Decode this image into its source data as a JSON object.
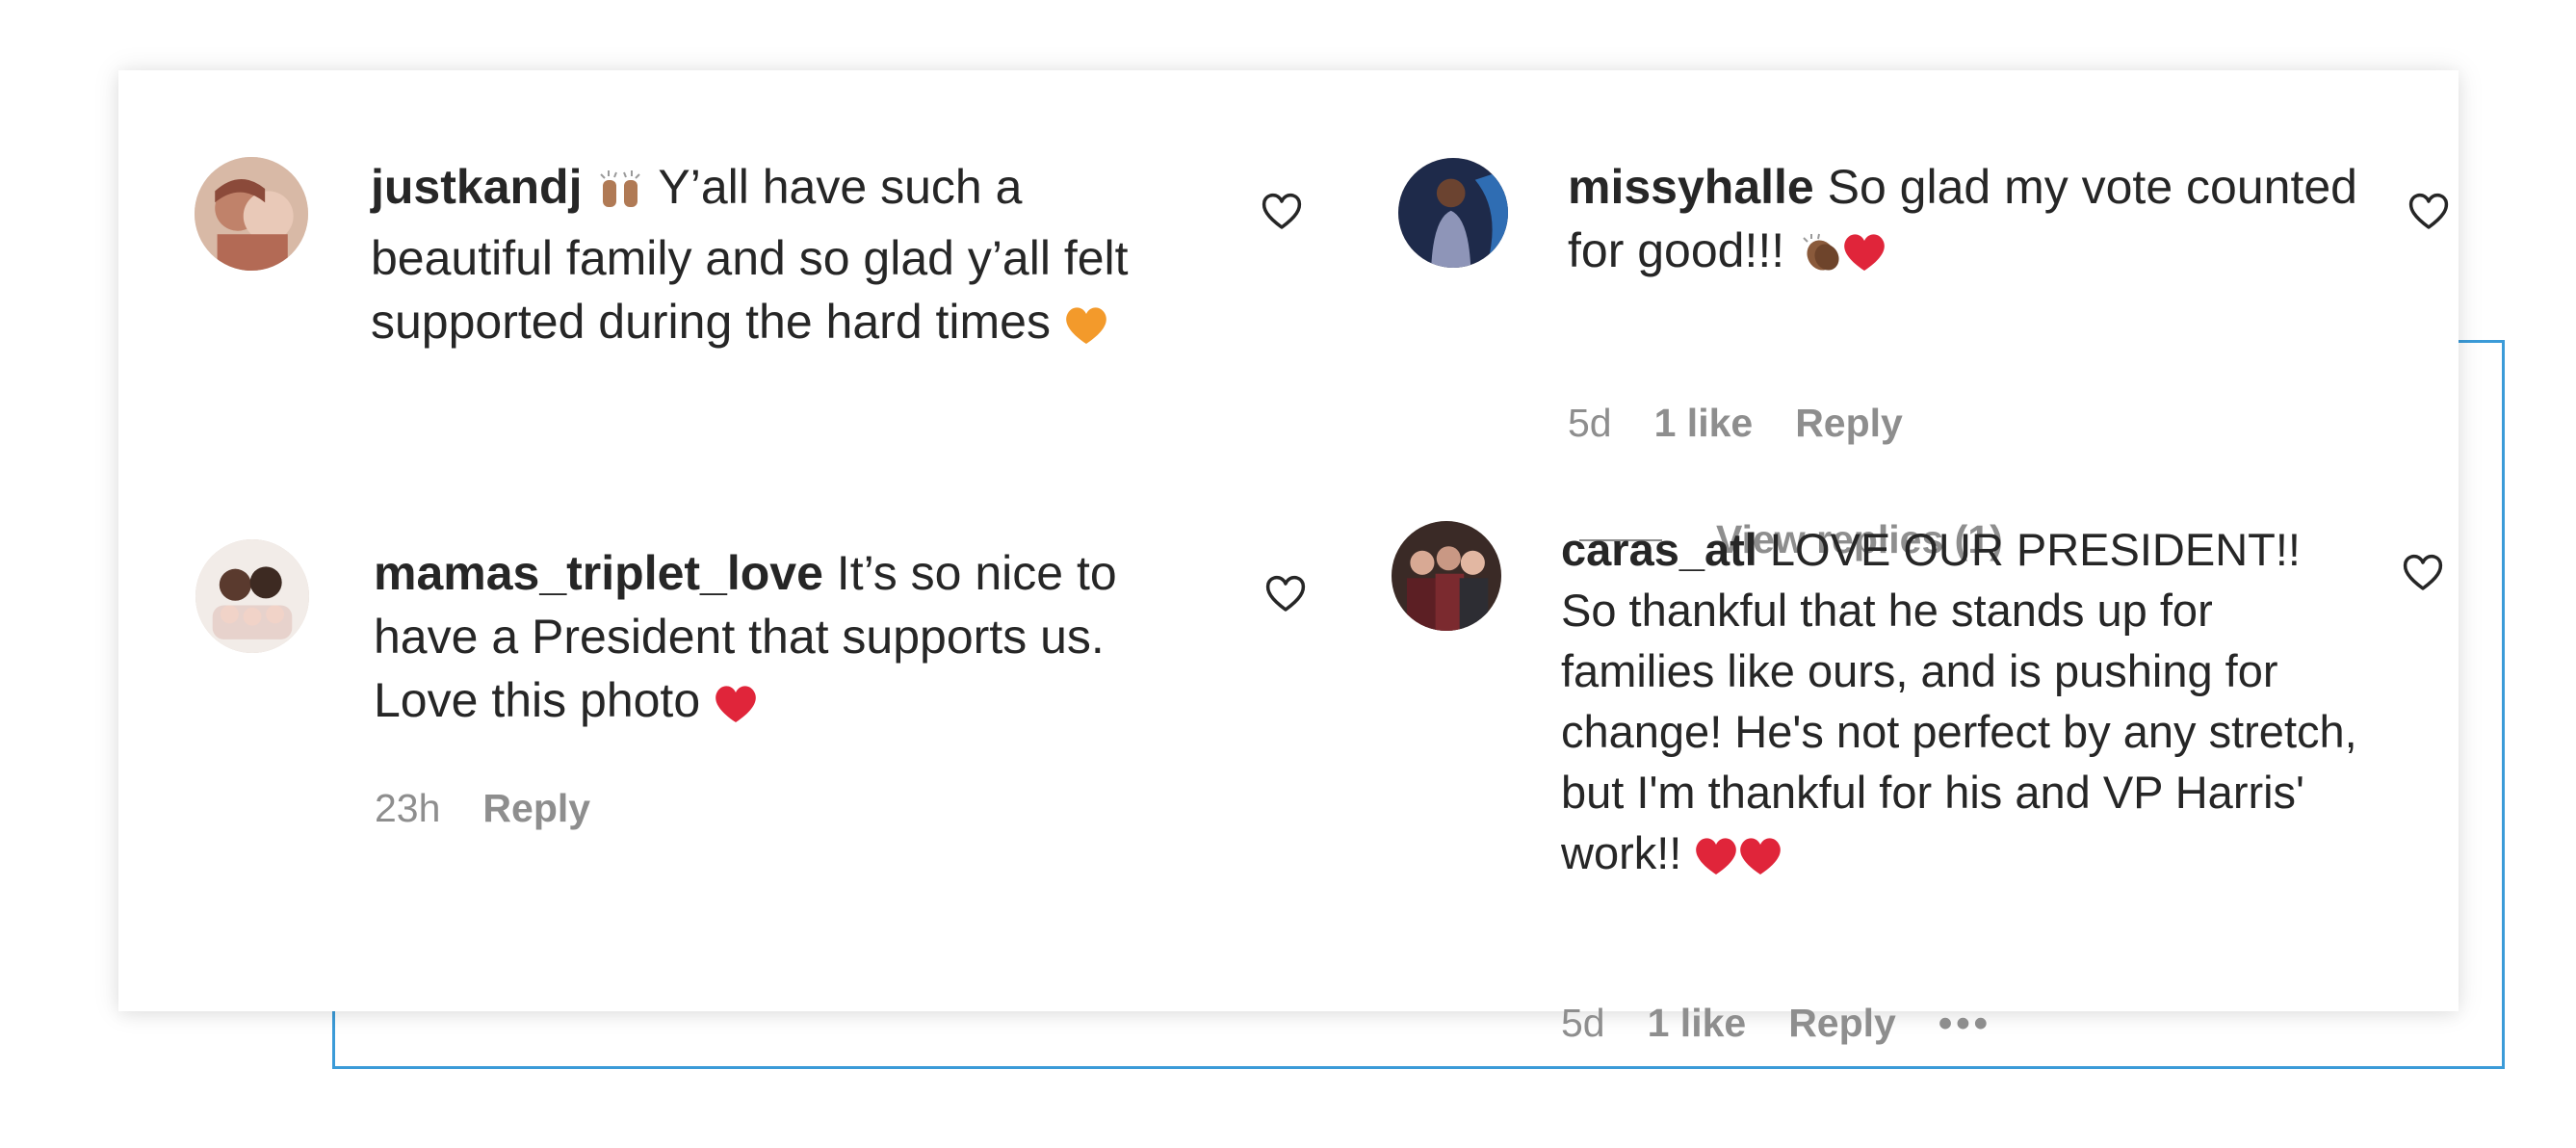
{
  "colors": {
    "accent_frame": "#3b9bd8",
    "text": "#262626",
    "muted": "#8e8e8e",
    "heart_emoji": "#e0253a",
    "orange_heart": "#f39a2b",
    "clap_tone": "#8a5a3b"
  },
  "comments": [
    {
      "username": "justkandj",
      "text_lead": " Y’all have such a",
      "text_rest": "beautiful family and so glad y’all felt supported during the hard times",
      "emoji_after_name": "raising-hands-icon",
      "emoji_end": "orange-heart-icon",
      "meta": {
        "time": "",
        "likes": "",
        "reply": ""
      }
    },
    {
      "username": "mamas_triplet_love",
      "text": " It’s so nice to have a President that supports us. Love this photo ",
      "emoji_end": "red-heart-icon",
      "meta": {
        "time": "23h",
        "reply": "Reply"
      }
    },
    {
      "username": "missyhalle",
      "text": " So glad my vote counted for good!!! ",
      "emoji_end": "clapping-hands-and-red-heart-icon",
      "meta": {
        "time": "5d",
        "likes": "1 like",
        "reply": "Reply"
      },
      "view_replies": "View replies (1)"
    },
    {
      "username": "caras_atl",
      "text": " LOVE OUR PRESIDENT!! So thankful that he stands up for families like ours, and is pushing for change! He's not perfect by any stretch, but I'm thankful for his and VP Harris' work!! ",
      "emoji_end": "two-red-hearts-icon",
      "meta": {
        "time": "5d",
        "likes": "1 like",
        "reply": "Reply",
        "more": "•••"
      }
    }
  ]
}
